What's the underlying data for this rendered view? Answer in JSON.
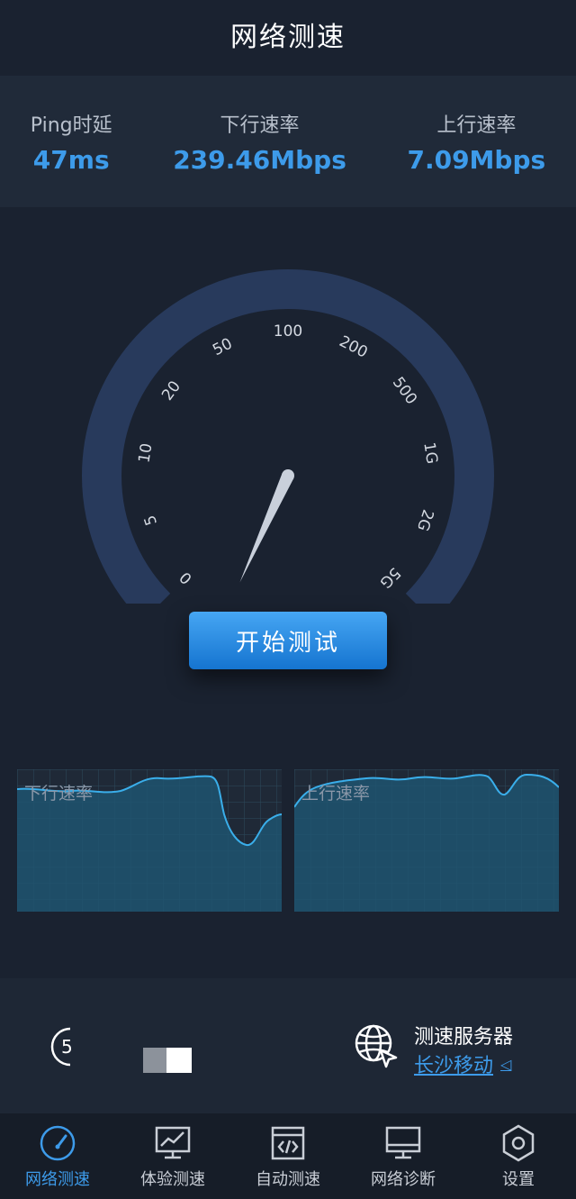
{
  "header": {
    "title": "网络测速"
  },
  "stats": {
    "ping": {
      "label": "Ping时延",
      "value": "47ms"
    },
    "download": {
      "label": "下行速率",
      "value": "239.46Mbps"
    },
    "upload": {
      "label": "上行速率",
      "value": "7.09Mbps"
    }
  },
  "gauge": {
    "scale_labels": [
      "0",
      "5",
      "10",
      "20",
      "50",
      "100",
      "200",
      "500",
      "1G",
      "2G",
      "5G"
    ],
    "needle_label_index": 5.9
  },
  "start_button": {
    "label": "开始测试"
  },
  "charts": {
    "download": {
      "label": "下行速率"
    },
    "upload": {
      "label": "上行速率"
    }
  },
  "bottom": {
    "timer_digit": "5",
    "server_label": "测速服务器",
    "server_name": "长沙移动"
  },
  "nav": {
    "items": [
      {
        "label": "网络测速",
        "icon": "speedometer-icon",
        "active": true
      },
      {
        "label": "体验测速",
        "icon": "chart-monitor-icon",
        "active": false
      },
      {
        "label": "自动测速",
        "icon": "code-window-icon",
        "active": false
      },
      {
        "label": "网络诊断",
        "icon": "monitor-icon",
        "active": false
      },
      {
        "label": "设置",
        "icon": "hexagon-gear-icon",
        "active": false
      }
    ]
  },
  "colors": {
    "accent": "#3d9bea",
    "background": "#1a2230",
    "panel": "#202a39",
    "gauge_band": "#283a5c"
  }
}
